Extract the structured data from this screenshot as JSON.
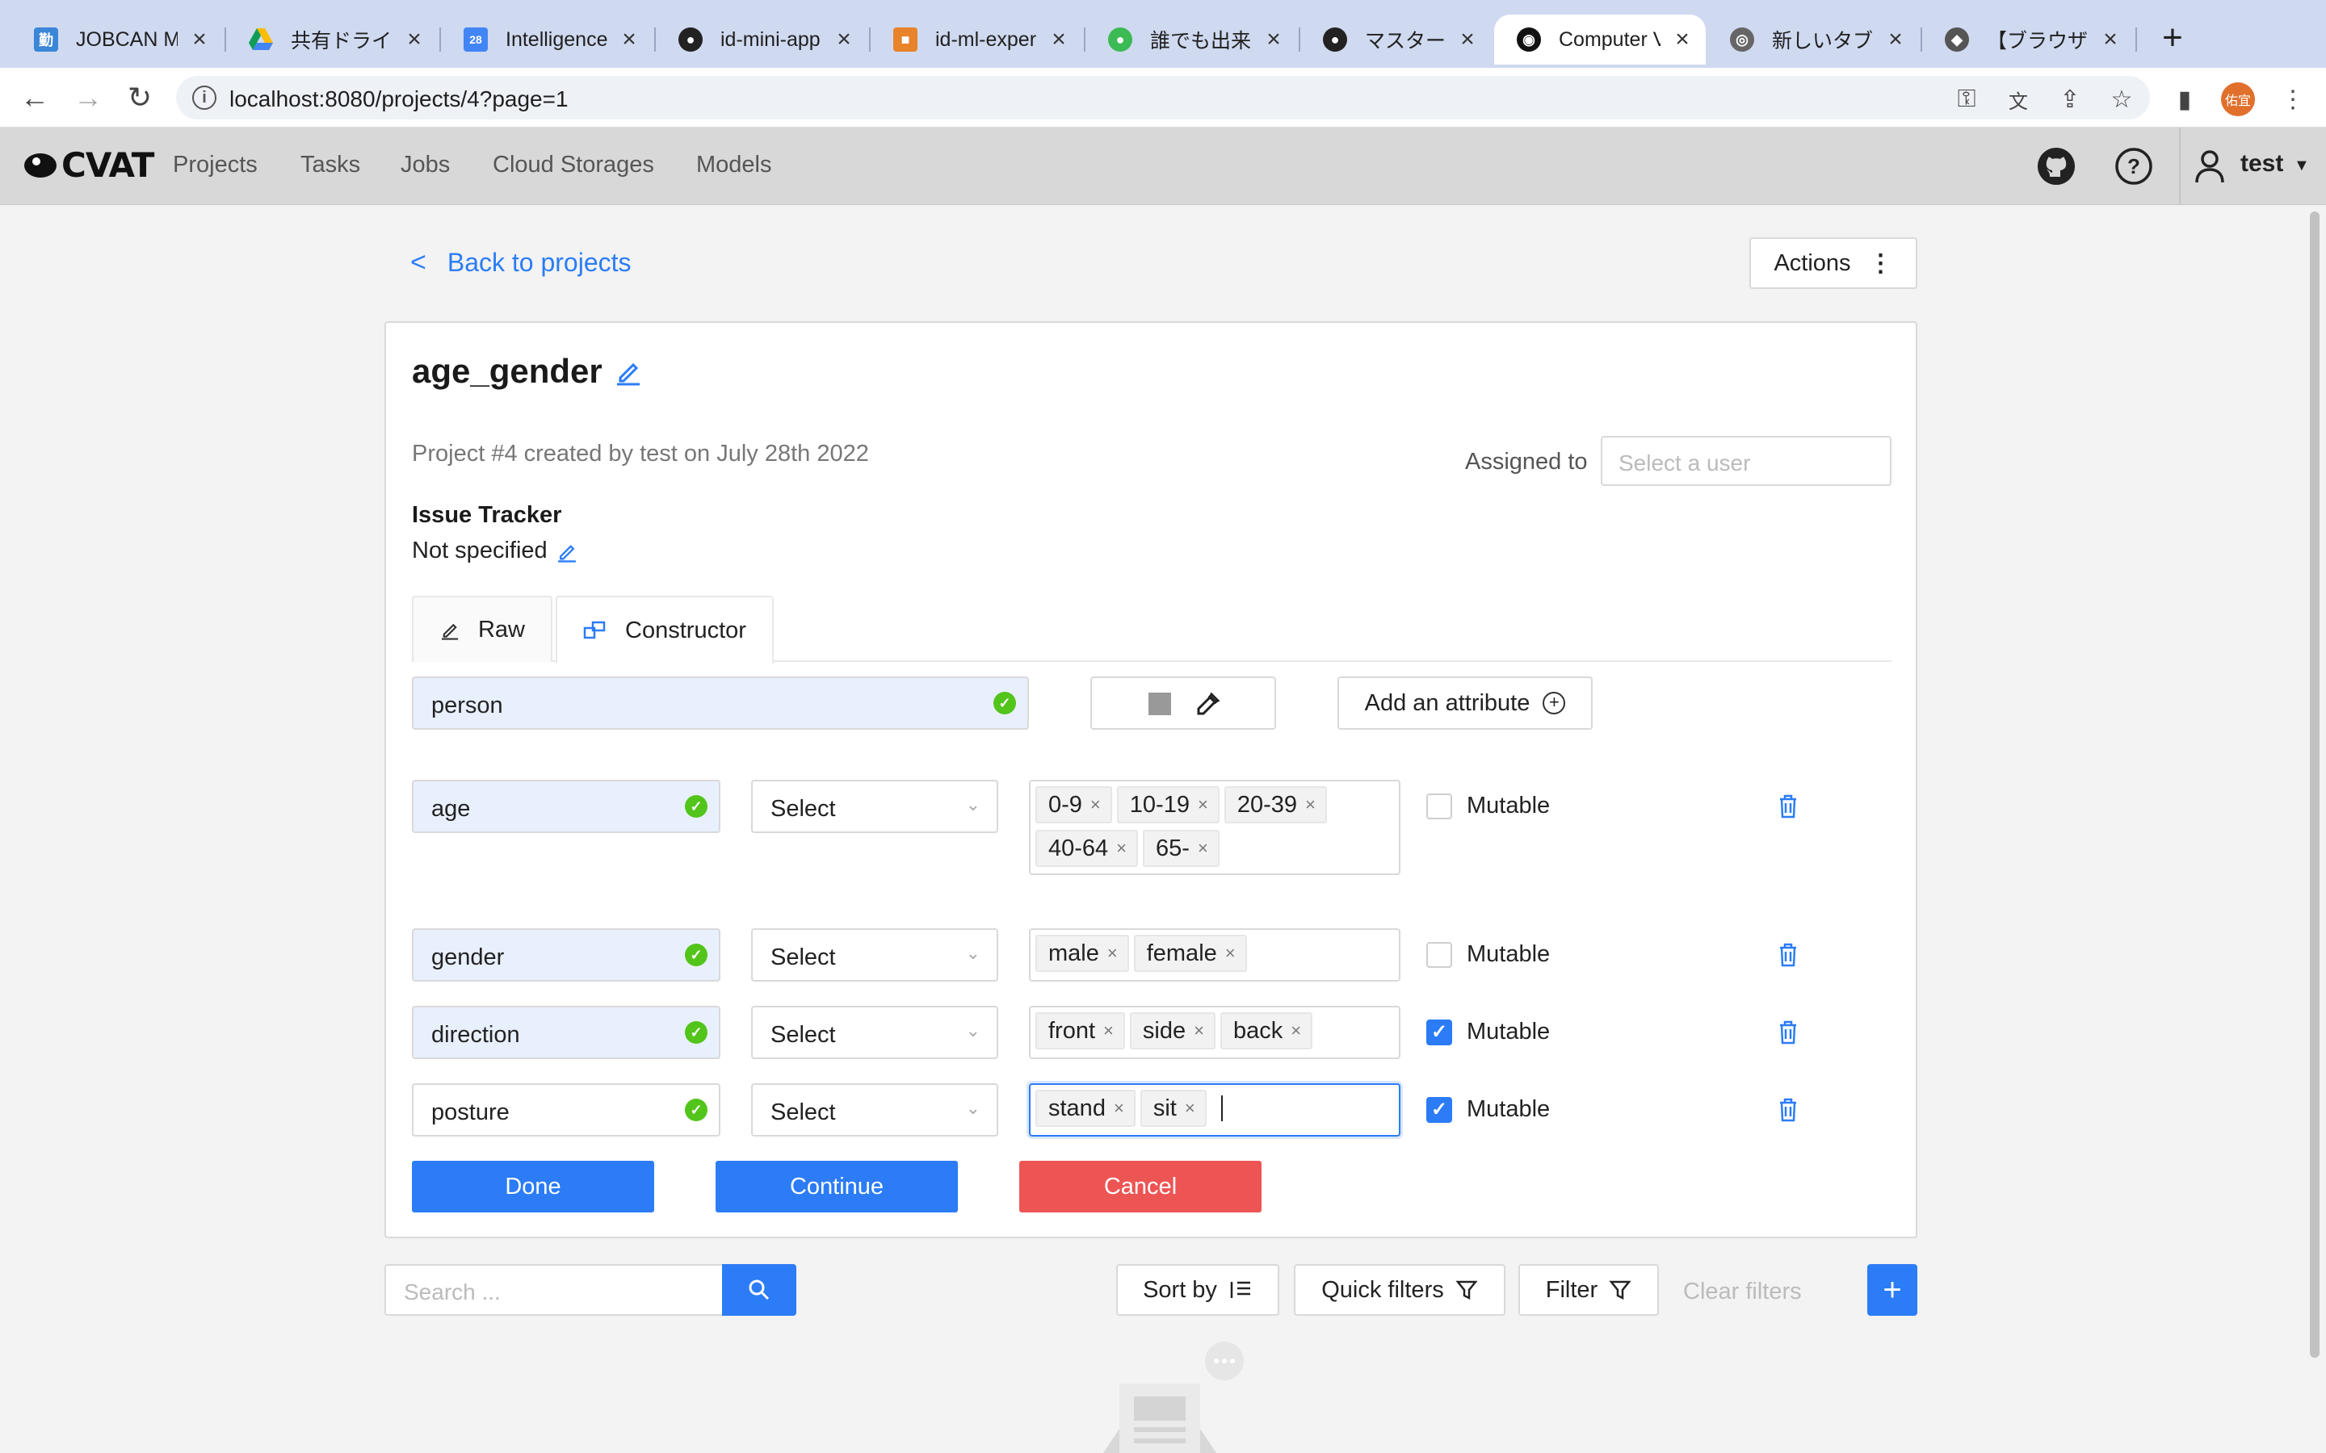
{
  "browser": {
    "tabs": [
      {
        "title": "JOBCAN My",
        "icon": "jobcan-icon",
        "color": "#3a86d8"
      },
      {
        "title": "共有ドライブ",
        "icon": "google-drive-icon",
        "color": "#34a853"
      },
      {
        "title": "Intelligence",
        "icon": "calendar-icon",
        "color": "#4285f4"
      },
      {
        "title": "id-mini-app",
        "icon": "github-icon",
        "color": "#222222"
      },
      {
        "title": "id-ml-exper",
        "icon": "box-icon",
        "color": "#e8832a"
      },
      {
        "title": "誰でも出来る",
        "icon": "green-circle-icon",
        "color": "#3cba54"
      },
      {
        "title": "マスターでの",
        "icon": "github-icon",
        "color": "#222222"
      },
      {
        "title": "Computer V",
        "icon": "cvat-icon",
        "color": "#111111"
      },
      {
        "title": "新しいタブ",
        "icon": "chrome-icon",
        "color": "#666666"
      },
      {
        "title": "【ブラウザ",
        "icon": "site-icon",
        "color": "#555555"
      }
    ],
    "url": "localhost:8080/projects/4?page=1",
    "profile_initials": "佑宜"
  },
  "header": {
    "logo_text": "CVAT",
    "menu": [
      "Projects",
      "Tasks",
      "Jobs",
      "Cloud Storages",
      "Models"
    ],
    "user": "test"
  },
  "page": {
    "back_link": "Back to projects",
    "actions_label": "Actions",
    "project_title": "age_gender",
    "meta": "Project #4 created by test on July 28th 2022",
    "assigned_label": "Assigned to",
    "assign_placeholder": "Select a user",
    "issue_tracker_title": "Issue Tracker",
    "issue_tracker_value": "Not specified",
    "tabs": {
      "raw": "Raw",
      "constructor": "Constructor"
    },
    "label_name": "person",
    "label_color": "#999999",
    "add_attribute": "Add an attribute",
    "attributes": [
      {
        "name": "age",
        "type": "Select",
        "values": [
          "0-9",
          "10-19",
          "20-39",
          "40-64",
          "65-"
        ],
        "mutable_label": "Mutable",
        "mutable": false
      },
      {
        "name": "gender",
        "type": "Select",
        "values": [
          "male",
          "female"
        ],
        "mutable_label": "Mutable",
        "mutable": false
      },
      {
        "name": "direction",
        "type": "Select",
        "values": [
          "front",
          "side",
          "back"
        ],
        "mutable_label": "Mutable",
        "mutable": true
      },
      {
        "name": "posture",
        "type": "Select",
        "values": [
          "stand",
          "sit"
        ],
        "mutable_label": "Mutable",
        "mutable": true
      }
    ],
    "buttons": {
      "done": "Done",
      "continue": "Continue",
      "cancel": "Cancel"
    }
  },
  "toolbar": {
    "search_placeholder": "Search ...",
    "sort_by": "Sort by",
    "quick_filters": "Quick filters",
    "filter": "Filter",
    "clear_filters": "Clear filters",
    "add": "+"
  },
  "colors": {
    "primary": "#2b7cf6",
    "danger": "#ed5454",
    "success": "#52c41a"
  }
}
